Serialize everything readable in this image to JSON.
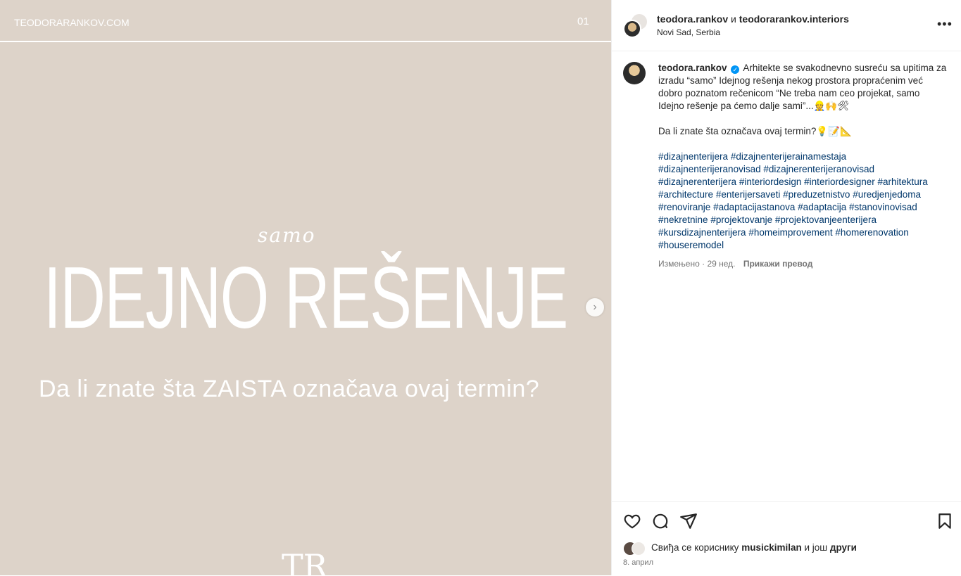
{
  "media": {
    "brand": "TEODORARANKOV.COM",
    "counter": "01",
    "script_word": "samo",
    "headline": "IDEJNO REŠENJE",
    "question": "Da li znate šta ZAISTA označava ovaj termin?",
    "monogram": "TR",
    "background": "#ddd3c9"
  },
  "header": {
    "user1": "teodora.rankov",
    "joiner": "и",
    "user2": "teodorarankov.interiors",
    "location": "Novi Sad, Serbia"
  },
  "caption": {
    "username": "teodora.rankov",
    "text1": "Arhitekte se svakodnevno susreću sa upitima za izradu “samo” Idejnog rešenja nekog prostora propraćenim već dobro poznatom rečenicom “Ne treba nam ceo projekat, samo Idejno rešenje pa ćemo dalje sami”...👷🙌🛠",
    "text2": "Da li znate šta označava ovaj termin?💡📝📐",
    "hashtags": [
      "#dizajnenterijera",
      "#dizajnenterijerainamestaja",
      "#dizajnenterijeranovisad",
      "#dizajnerenterijeranovisad",
      "#dizajnerenterijera",
      "#interiordesign",
      "#interiordesigner",
      "#arhitektura",
      "#architecture",
      "#enterijersaveti",
      "#preduzetnistvo",
      "#uredjenjedoma",
      "#renoviranje",
      "#adaptacijastanova",
      "#adaptacija",
      "#stanovinovisad",
      "#nekretnine",
      "#projektovanje",
      "#projektovanjeenterijera",
      "#kursdizajnenterijera",
      "#homeimprovement",
      "#homerenovation",
      "#houseremodel"
    ],
    "edited": "Измењено · 29 нед.",
    "translate": "Прикажи превод"
  },
  "likes": {
    "prefix": "Свиђа се кориснику",
    "user": "musickimilan",
    "middle": "и још",
    "others": "други"
  },
  "date": "8. април",
  "icons": [
    "heart-icon",
    "comment-icon",
    "share-icon",
    "bookmark-icon",
    "more-icon",
    "chevron-right-icon",
    "verified-icon"
  ]
}
